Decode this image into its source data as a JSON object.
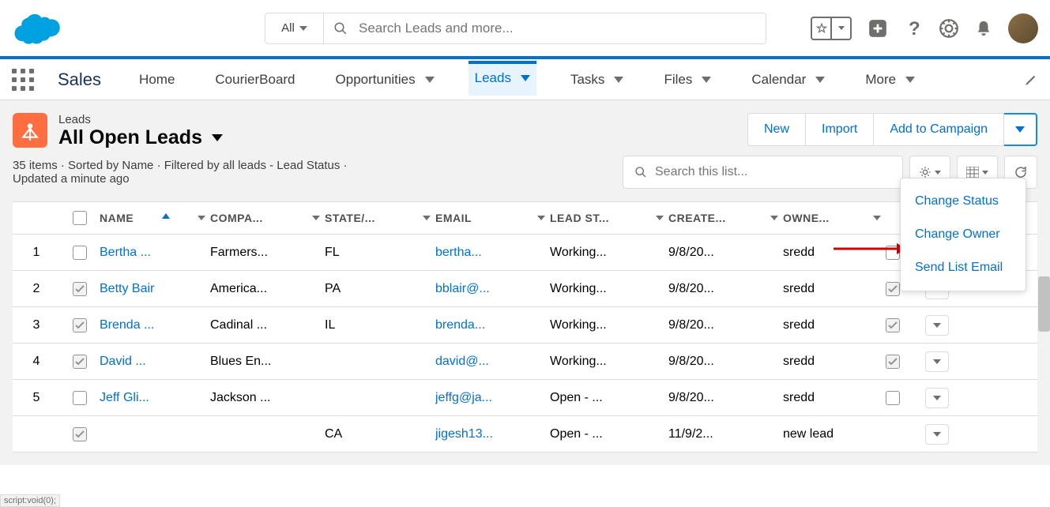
{
  "header": {
    "search_filter": "All",
    "search_placeholder": "Search Leads and more..."
  },
  "nav": {
    "app_name": "Sales",
    "tabs": [
      "Home",
      "CourierBoard",
      "Opportunities",
      "Leads",
      "Tasks",
      "Files",
      "Calendar",
      "More"
    ],
    "active_tab": "Leads"
  },
  "page": {
    "object_label": "Leads",
    "view_name": "All Open Leads",
    "meta_line1": "35 items · Sorted by Name · Filtered by all leads - Lead Status ·",
    "meta_line2": "Updated a minute ago",
    "buttons": {
      "new": "New",
      "import": "Import",
      "campaign": "Add to Campaign"
    },
    "list_search_placeholder": "Search this list..."
  },
  "dropdown": {
    "items": [
      "Change Status",
      "Change Owner",
      "Send List Email"
    ]
  },
  "columns": {
    "name": "NAME",
    "company": "COMPA...",
    "state": "STATE/...",
    "email": "EMAIL",
    "status": "LEAD ST...",
    "created": "CREATE...",
    "owner": "OWNE..."
  },
  "rows": [
    {
      "num": "1",
      "name": "Bertha ...",
      "company": "Farmers...",
      "state": "FL",
      "email": "bertha...",
      "status": "Working...",
      "created": "9/8/20...",
      "owner": "sredd",
      "checked": false
    },
    {
      "num": "2",
      "name": "Betty Bair",
      "company": "America...",
      "state": "PA",
      "email": "bblair@...",
      "status": "Working...",
      "created": "9/8/20...",
      "owner": "sredd",
      "checked": true
    },
    {
      "num": "3",
      "name": "Brenda ...",
      "company": "Cadinal ...",
      "state": "IL",
      "email": "brenda...",
      "status": "Working...",
      "created": "9/8/20...",
      "owner": "sredd",
      "checked": true
    },
    {
      "num": "4",
      "name": "David ...",
      "company": "Blues En...",
      "state": "",
      "email": "david@...",
      "status": "Working...",
      "created": "9/8/20...",
      "owner": "sredd",
      "checked": true
    },
    {
      "num": "5",
      "name": "Jeff Gli...",
      "company": "Jackson ...",
      "state": "",
      "email": "jeffg@ja...",
      "status": "Open - ...",
      "created": "9/8/20...",
      "owner": "sredd",
      "checked": false
    },
    {
      "num": "",
      "name": "",
      "company": "",
      "state": "CA",
      "email": "jigesh13...",
      "status": "Open - ...",
      "created": "11/9/2...",
      "owner": "new lead",
      "checked": true
    }
  ],
  "status_bar": "script:void(0);"
}
